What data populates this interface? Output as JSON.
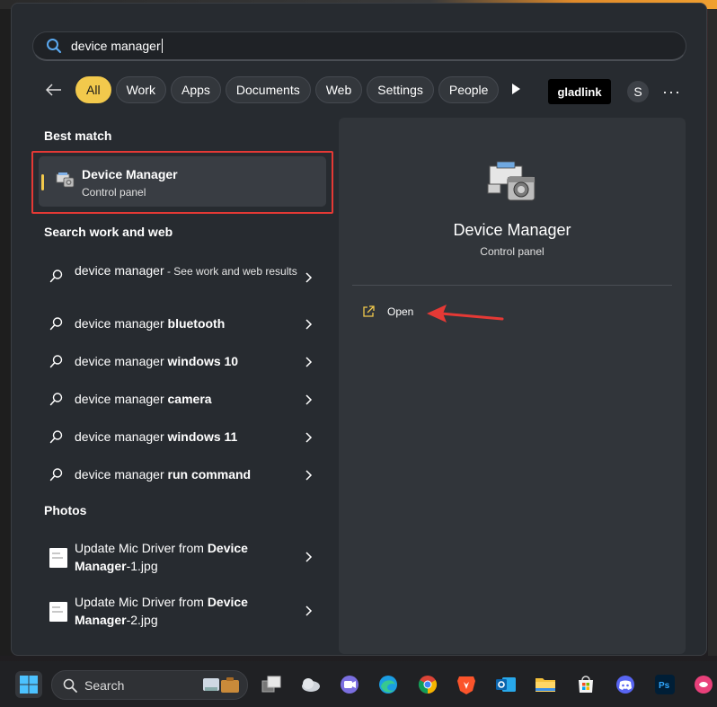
{
  "search": {
    "query": "device manager"
  },
  "filters": {
    "chips": [
      "All",
      "Work",
      "Apps",
      "Documents",
      "Web",
      "Settings",
      "People"
    ],
    "active": "All",
    "org_badge": "gladlink",
    "avatar_initial": "S",
    "more": "···"
  },
  "results": {
    "best_match_heading": "Best match",
    "best_match": {
      "title": "Device Manager",
      "subtitle": "Control panel"
    },
    "web_heading": "Search work and web",
    "web_items": [
      {
        "prefix": "device manager",
        "bold": "",
        "suffix": " - See work and web results"
      },
      {
        "prefix": "device manager ",
        "bold": "bluetooth",
        "suffix": ""
      },
      {
        "prefix": "device manager ",
        "bold": "windows 10",
        "suffix": ""
      },
      {
        "prefix": "device manager ",
        "bold": "camera",
        "suffix": ""
      },
      {
        "prefix": "device manager ",
        "bold": "windows 11",
        "suffix": ""
      },
      {
        "prefix": "device manager ",
        "bold": "run command",
        "suffix": ""
      }
    ],
    "photos_heading": "Photos",
    "photos": [
      {
        "text": "Update Mic Driver from ",
        "bold": "Device",
        "line2_bold": "Manager",
        "line2_rest": "-1.jpg"
      },
      {
        "text": "Update Mic Driver from ",
        "bold": "Device",
        "line2_bold": "Manager",
        "line2_rest": "-2.jpg"
      }
    ]
  },
  "preview": {
    "title": "Device Manager",
    "subtitle": "Control panel",
    "action_open": "Open"
  },
  "taskbar": {
    "search_label": "Search"
  },
  "colors": {
    "accent": "#f2c94c",
    "highlight_box": "#e53935",
    "panel_bg": "#272b30",
    "preview_bg": "#31353a"
  }
}
